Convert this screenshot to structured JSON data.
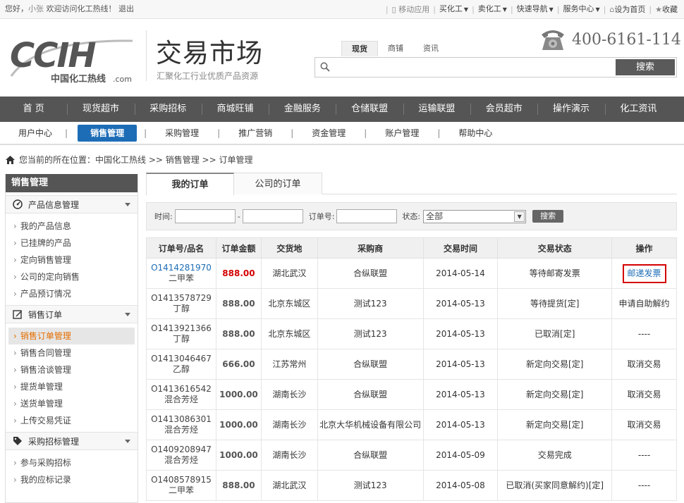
{
  "topbar": {
    "greeting": "您好，",
    "user": "小张",
    "welcome": " 欢迎访问化工热线！",
    "logout": "退出",
    "mobile": "移动应用",
    "buy": "买化工",
    "sell": "卖化工",
    "quicknav": "快速导航",
    "service": "服务中心",
    "homepage": "设为首页",
    "favorite": "收藏"
  },
  "header": {
    "logo_text": "CCIH",
    "logo_cn": "中国化工热线",
    "logo_com": ".com",
    "title": "交易市场",
    "subtitle": "汇聚化工行业优质产品资源",
    "search_tabs": [
      "现货",
      "商铺",
      "资讯"
    ],
    "search_placeholder": "",
    "search_button": "搜索",
    "phone": "400-6161-114"
  },
  "mainnav": [
    "首 页",
    "现货超市",
    "采购招标",
    "商城旺铺",
    "金融服务",
    "仓储联盟",
    "运输联盟",
    "会员超市",
    "操作演示",
    "化工资讯"
  ],
  "subnav": [
    "用户中心",
    "销售管理",
    "采购管理",
    "推广营销",
    "资金管理",
    "账户管理",
    "帮助中心"
  ],
  "breadcrumb": "您当前的所在位置：中国化工热线 >> 销售管理 >> 订单管理",
  "sidebar": {
    "title": "销售管理",
    "sections": [
      {
        "title": "产品信息管理",
        "items": [
          "我的产品信息",
          "已挂牌的产品",
          "定向销售管理",
          "公司的定向销售",
          "产品预订情况"
        ]
      },
      {
        "title": "销售订单",
        "items": [
          "销售订单管理",
          "销售合同管理",
          "销售洽谈管理",
          "提货单管理",
          "送货单管理",
          "上传交易凭证"
        ]
      },
      {
        "title": "采购招标管理",
        "items": [
          "参与采购招标",
          "我的应标记录"
        ]
      }
    ]
  },
  "order_tabs": [
    "我的订单",
    "公司的订单"
  ],
  "filter": {
    "time_label": "时间:",
    "dash": "-",
    "order_label": "订单号:",
    "status_label": "状态:",
    "status_value": "全部",
    "search": "搜索"
  },
  "table": {
    "headers": [
      "订单号/品名",
      "订单金额",
      "交货地",
      "采购商",
      "交易时间",
      "交易状态",
      "操作"
    ],
    "rows": [
      {
        "id": "O1414281970",
        "product": "二甲苯",
        "amount": "888.00",
        "place": "湖北武汉",
        "buyer": "合纵联盟",
        "time": "2014-05-14",
        "status": "等待邮寄发票",
        "action": "邮递发票"
      },
      {
        "id": "O1413578729",
        "product": "丁醇",
        "amount": "888.00",
        "place": "北京东城区",
        "buyer": "测试123",
        "time": "2014-05-13",
        "status": "等待提货[定]",
        "action": "申请自助解约"
      },
      {
        "id": "O1413921366",
        "product": "丁醇",
        "amount": "888.00",
        "place": "北京东城区",
        "buyer": "测试123",
        "time": "2014-05-13",
        "status": "已取消[定]",
        "action": "----"
      },
      {
        "id": "O1413046467",
        "product": "乙醇",
        "amount": "666.00",
        "place": "江苏常州",
        "buyer": "合纵联盟",
        "time": "2014-05-13",
        "status": "新定向交易[定]",
        "action": "取消交易"
      },
      {
        "id": "O1413616542",
        "product": "混合芳烃",
        "amount": "1000.00",
        "place": "湖南长沙",
        "buyer": "合纵联盟",
        "time": "2014-05-13",
        "status": "新定向交易[定]",
        "action": "取消交易"
      },
      {
        "id": "O1413086301",
        "product": "混合芳烃",
        "amount": "1000.00",
        "place": "湖南长沙",
        "buyer": "北京大华机械设备有限公司",
        "time": "2014-05-13",
        "status": "新定向交易[定]",
        "action": "取消交易"
      },
      {
        "id": "O1409208947",
        "product": "混合芳烃",
        "amount": "1000.00",
        "place": "湖南长沙",
        "buyer": "合纵联盟",
        "time": "2014-05-09",
        "status": "交易完成",
        "action": "----"
      },
      {
        "id": "O1408578915",
        "product": "二甲苯",
        "amount": "888.00",
        "place": "湖北武汉",
        "buyer": "测试123",
        "time": "2014-05-08",
        "status": "已取消(买家同意解约)[定]",
        "action": "----"
      }
    ]
  },
  "colors": {
    "accent": "#1d6db6",
    "nav_bg": "#555555",
    "alert": "#d40000",
    "active_side": "#e46d00"
  }
}
